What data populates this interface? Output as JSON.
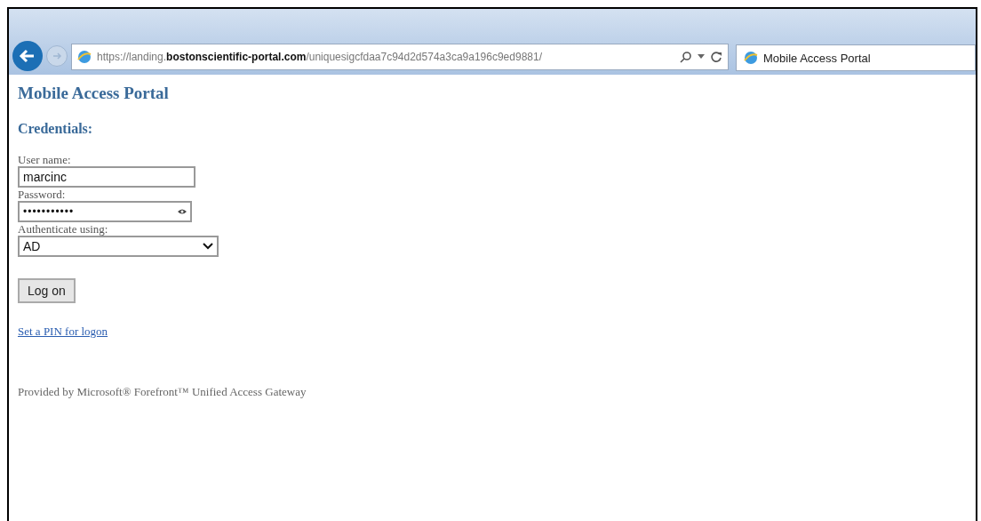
{
  "browser": {
    "address": "https://landing.**bostonscientific-portal.com**/uniquesigcfdaa7c94d2d574a3ca9a196c9ed9881/",
    "tabs": [
      {
        "label": "Mobile Access Portal",
        "selected": true
      }
    ]
  },
  "page": {
    "title": "Mobile Access Portal",
    "section": "Credentials:",
    "fields": [
      {
        "kind": "text",
        "label": "User name:",
        "value": "marcinc"
      },
      {
        "kind": "password",
        "label": "Password:",
        "value": "•••••••••••"
      },
      {
        "kind": "select",
        "label": "Authenticate using:",
        "value": "AD"
      }
    ],
    "button": "Log on",
    "link": "Set a PIN for logon",
    "footer": "Provided by Microsoft® Forefront™ Unified Access Gateway"
  }
}
